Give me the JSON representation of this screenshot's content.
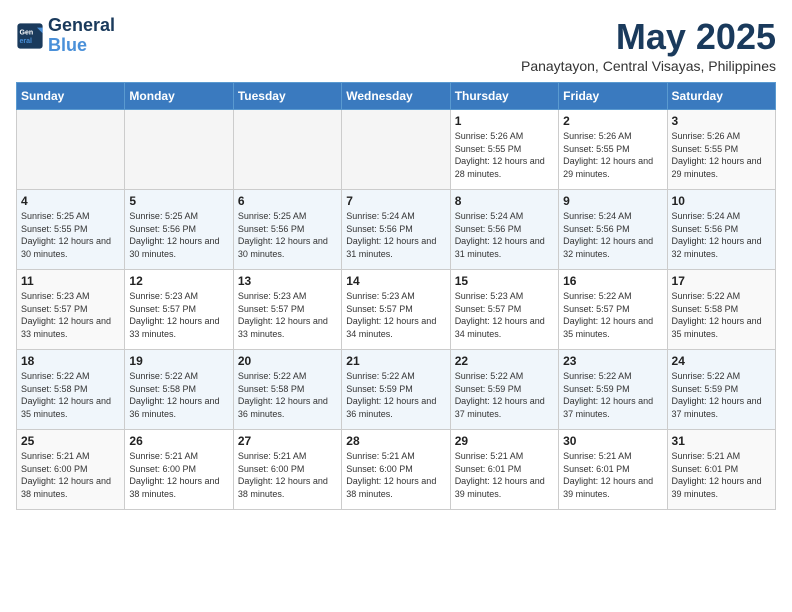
{
  "logo": {
    "line1": "General",
    "line2": "Blue"
  },
  "title": "May 2025",
  "subtitle": "Panaytayon, Central Visayas, Philippines",
  "weekdays": [
    "Sunday",
    "Monday",
    "Tuesday",
    "Wednesday",
    "Thursday",
    "Friday",
    "Saturday"
  ],
  "weeks": [
    [
      {
        "day": "",
        "empty": true
      },
      {
        "day": "",
        "empty": true
      },
      {
        "day": "",
        "empty": true
      },
      {
        "day": "",
        "empty": true
      },
      {
        "day": "1",
        "sunrise": "5:26 AM",
        "sunset": "5:55 PM",
        "daylight": "12 hours and 28 minutes."
      },
      {
        "day": "2",
        "sunrise": "5:26 AM",
        "sunset": "5:55 PM",
        "daylight": "12 hours and 29 minutes."
      },
      {
        "day": "3",
        "sunrise": "5:26 AM",
        "sunset": "5:55 PM",
        "daylight": "12 hours and 29 minutes."
      }
    ],
    [
      {
        "day": "4",
        "sunrise": "5:25 AM",
        "sunset": "5:55 PM",
        "daylight": "12 hours and 30 minutes."
      },
      {
        "day": "5",
        "sunrise": "5:25 AM",
        "sunset": "5:56 PM",
        "daylight": "12 hours and 30 minutes."
      },
      {
        "day": "6",
        "sunrise": "5:25 AM",
        "sunset": "5:56 PM",
        "daylight": "12 hours and 30 minutes."
      },
      {
        "day": "7",
        "sunrise": "5:24 AM",
        "sunset": "5:56 PM",
        "daylight": "12 hours and 31 minutes."
      },
      {
        "day": "8",
        "sunrise": "5:24 AM",
        "sunset": "5:56 PM",
        "daylight": "12 hours and 31 minutes."
      },
      {
        "day": "9",
        "sunrise": "5:24 AM",
        "sunset": "5:56 PM",
        "daylight": "12 hours and 32 minutes."
      },
      {
        "day": "10",
        "sunrise": "5:24 AM",
        "sunset": "5:56 PM",
        "daylight": "12 hours and 32 minutes."
      }
    ],
    [
      {
        "day": "11",
        "sunrise": "5:23 AM",
        "sunset": "5:57 PM",
        "daylight": "12 hours and 33 minutes."
      },
      {
        "day": "12",
        "sunrise": "5:23 AM",
        "sunset": "5:57 PM",
        "daylight": "12 hours and 33 minutes."
      },
      {
        "day": "13",
        "sunrise": "5:23 AM",
        "sunset": "5:57 PM",
        "daylight": "12 hours and 33 minutes."
      },
      {
        "day": "14",
        "sunrise": "5:23 AM",
        "sunset": "5:57 PM",
        "daylight": "12 hours and 34 minutes."
      },
      {
        "day": "15",
        "sunrise": "5:23 AM",
        "sunset": "5:57 PM",
        "daylight": "12 hours and 34 minutes."
      },
      {
        "day": "16",
        "sunrise": "5:22 AM",
        "sunset": "5:57 PM",
        "daylight": "12 hours and 35 minutes."
      },
      {
        "day": "17",
        "sunrise": "5:22 AM",
        "sunset": "5:58 PM",
        "daylight": "12 hours and 35 minutes."
      }
    ],
    [
      {
        "day": "18",
        "sunrise": "5:22 AM",
        "sunset": "5:58 PM",
        "daylight": "12 hours and 35 minutes."
      },
      {
        "day": "19",
        "sunrise": "5:22 AM",
        "sunset": "5:58 PM",
        "daylight": "12 hours and 36 minutes."
      },
      {
        "day": "20",
        "sunrise": "5:22 AM",
        "sunset": "5:58 PM",
        "daylight": "12 hours and 36 minutes."
      },
      {
        "day": "21",
        "sunrise": "5:22 AM",
        "sunset": "5:59 PM",
        "daylight": "12 hours and 36 minutes."
      },
      {
        "day": "22",
        "sunrise": "5:22 AM",
        "sunset": "5:59 PM",
        "daylight": "12 hours and 37 minutes."
      },
      {
        "day": "23",
        "sunrise": "5:22 AM",
        "sunset": "5:59 PM",
        "daylight": "12 hours and 37 minutes."
      },
      {
        "day": "24",
        "sunrise": "5:22 AM",
        "sunset": "5:59 PM",
        "daylight": "12 hours and 37 minutes."
      }
    ],
    [
      {
        "day": "25",
        "sunrise": "5:21 AM",
        "sunset": "6:00 PM",
        "daylight": "12 hours and 38 minutes."
      },
      {
        "day": "26",
        "sunrise": "5:21 AM",
        "sunset": "6:00 PM",
        "daylight": "12 hours and 38 minutes."
      },
      {
        "day": "27",
        "sunrise": "5:21 AM",
        "sunset": "6:00 PM",
        "daylight": "12 hours and 38 minutes."
      },
      {
        "day": "28",
        "sunrise": "5:21 AM",
        "sunset": "6:00 PM",
        "daylight": "12 hours and 38 minutes."
      },
      {
        "day": "29",
        "sunrise": "5:21 AM",
        "sunset": "6:01 PM",
        "daylight": "12 hours and 39 minutes."
      },
      {
        "day": "30",
        "sunrise": "5:21 AM",
        "sunset": "6:01 PM",
        "daylight": "12 hours and 39 minutes."
      },
      {
        "day": "31",
        "sunrise": "5:21 AM",
        "sunset": "6:01 PM",
        "daylight": "12 hours and 39 minutes."
      }
    ]
  ]
}
